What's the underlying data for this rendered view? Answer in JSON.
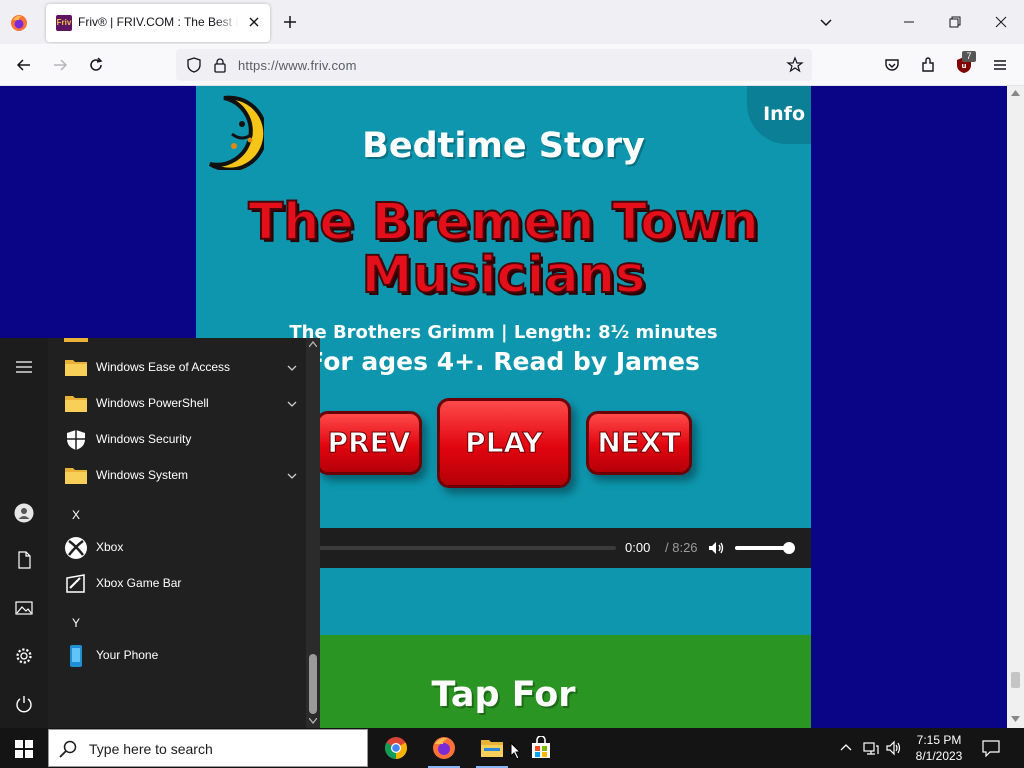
{
  "browser": {
    "tab_title": "Friv® | FRIV.COM : The Best Free Games",
    "favicon_text": "Friv",
    "url": "https://www.friv.com",
    "extension_badge": "7"
  },
  "game": {
    "heading": "Bedtime Story",
    "story_title_line1": "The Bremen Town",
    "story_title_line2": "Musicians",
    "author_length": "The Brothers Grimm | Length: 8½ minutes",
    "ages_reader": "For ages 4+. Read by James",
    "info_label": "Info",
    "prev_label": "PREV",
    "play_label": "PLAY",
    "next_label": "NEXT",
    "footer_heading": "Tap For"
  },
  "player": {
    "current_time": "0:00",
    "duration": "/ 8:26",
    "progress_fraction": 0.02,
    "volume_fraction": 1.0
  },
  "start_menu": {
    "items": [
      {
        "label": "Windows Ease of Access",
        "icon": "folder-icon",
        "expandable": true
      },
      {
        "label": "Windows PowerShell",
        "icon": "folder-icon",
        "expandable": true
      },
      {
        "label": "Windows Security",
        "icon": "shield-icon",
        "expandable": false
      },
      {
        "label": "Windows System",
        "icon": "folder-icon",
        "expandable": true
      }
    ],
    "letter_x": "X",
    "items_x": [
      {
        "label": "Xbox",
        "icon": "xbox-icon"
      },
      {
        "label": "Xbox Game Bar",
        "icon": "xbox-game-bar-icon"
      }
    ],
    "letter_y": "Y",
    "items_y": [
      {
        "label": "Your Phone",
        "icon": "phone-icon"
      }
    ]
  },
  "taskbar": {
    "search_placeholder": "Type here to search",
    "time": "7:15 PM",
    "date": "8/1/2023",
    "apps": [
      "chrome-icon",
      "firefox-icon",
      "file-explorer-icon",
      "microsoft-store-icon"
    ]
  },
  "colors": {
    "page_bg": "#0a0586",
    "game_bg": "#0d96ae",
    "title_red": "#e3101c",
    "button_red": "#e1050f",
    "green_panel": "#2b9523"
  }
}
